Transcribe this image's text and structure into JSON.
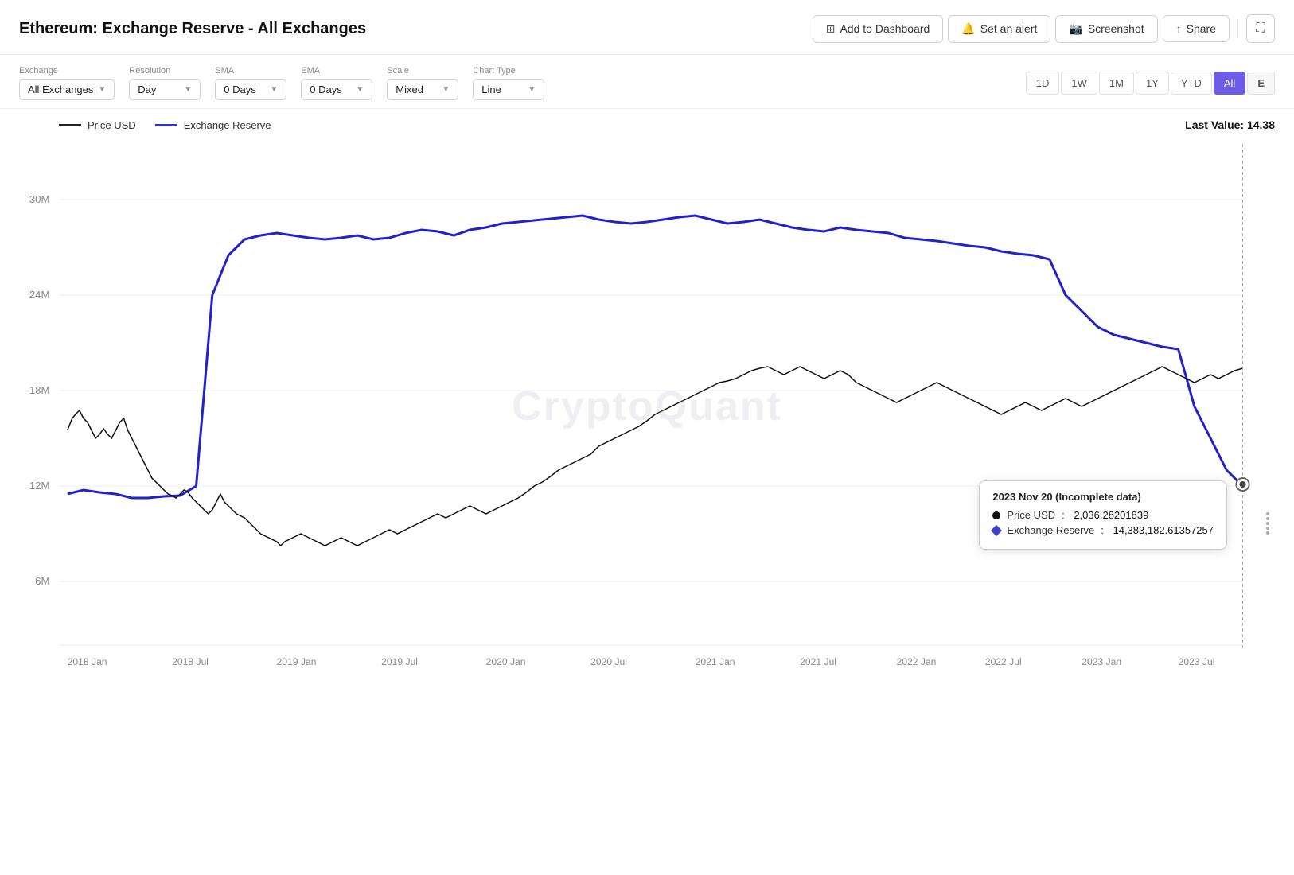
{
  "header": {
    "title": "Ethereum: Exchange Reserve - All Exchanges",
    "actions": {
      "add_to_dashboard": "Add to Dashboard",
      "set_alert": "Set an alert",
      "screenshot": "Screenshot",
      "share": "Share"
    }
  },
  "controls": {
    "exchange": {
      "label": "Exchange",
      "value": "All Exchanges"
    },
    "resolution": {
      "label": "Resolution",
      "value": "Day"
    },
    "sma": {
      "label": "SMA",
      "value": "0 Days"
    },
    "ema": {
      "label": "EMA",
      "value": "0 Days"
    },
    "scale": {
      "label": "Scale",
      "value": "Mixed"
    },
    "chart_type": {
      "label": "Chart Type",
      "value": "Line"
    }
  },
  "time_buttons": [
    "1D",
    "1W",
    "1M",
    "1Y",
    "YTD",
    "All"
  ],
  "active_time": "All",
  "edge_time_label": "E",
  "chart": {
    "legend": {
      "price_label": "Price USD",
      "reserve_label": "Exchange Reserve"
    },
    "last_value_label": "Last Value: 14.38",
    "watermark": "CryptoQuant",
    "y_axis_labels": [
      "6M",
      "12M",
      "18M",
      "24M",
      "30M"
    ],
    "x_axis_labels": [
      "2018 Jan",
      "2018 Jul",
      "2019 Jan",
      "2019 Jul",
      "2020 Jan",
      "2020 Jul",
      "2021 Jan",
      "2021 Jul",
      "2022 Jan",
      "2022 Jul",
      "2023 Jan",
      "2023 Jul"
    ]
  },
  "tooltip": {
    "date": "2023 Nov 20 (Incomplete data)",
    "price_label": "Price USD",
    "price_value": "2,036.28201839",
    "reserve_label": "Exchange Reserve",
    "reserve_value": "14,383,182.61357257"
  }
}
